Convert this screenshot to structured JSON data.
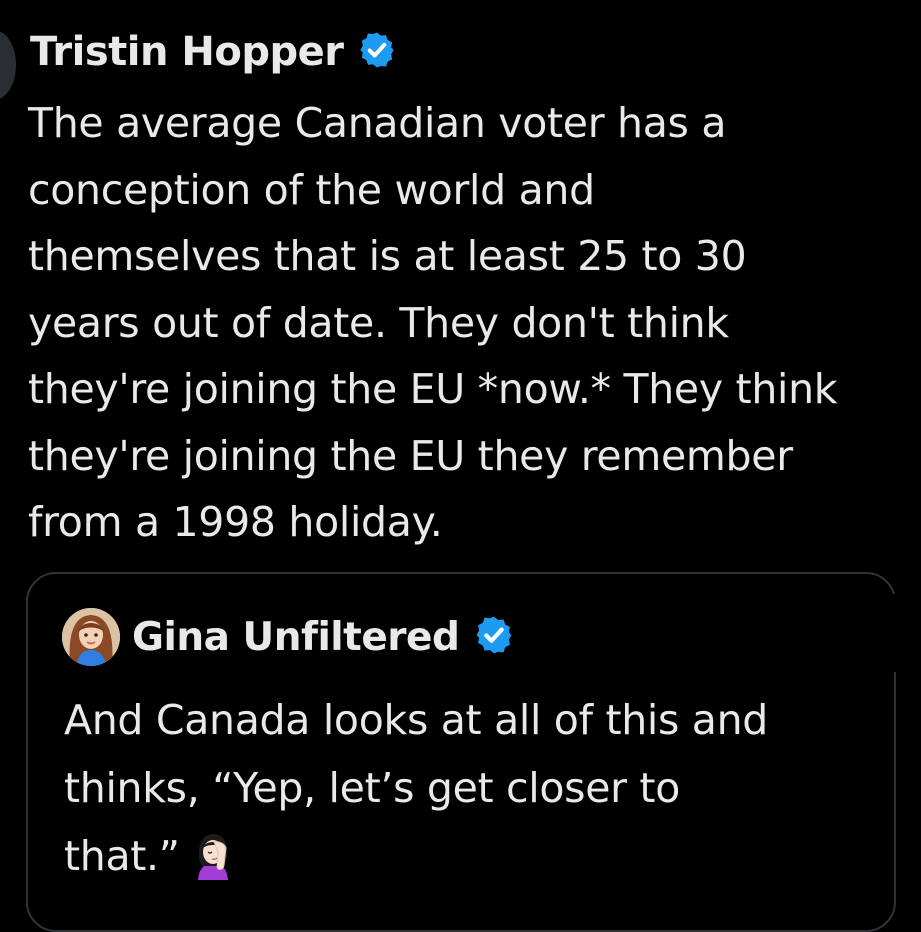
{
  "tweet": {
    "author_name": "Tristin Hopper",
    "verified_icon": "verified-badge-icon",
    "text": "The average Canadian voter has a\nconception of the world and\nthemselves that is at least 25 to 30\nyears out of date. They don't think\nthey're joining the EU *now.* They think\nthey're joining the EU they remember\nfrom a 1998 holiday."
  },
  "quoted_tweet": {
    "author_name": "Gina Unfiltered",
    "avatar_icon": "profile-avatar",
    "verified_icon": "verified-badge-icon",
    "text": "And Canada looks at all of this and\nthinks, “Yep, let’s get closer to\nthat.”",
    "emoji_icon": "facepalm-emoji-icon"
  },
  "colors": {
    "background": "#000000",
    "text": "#e7e9ea",
    "verified_blue": "#1d9bf0",
    "card_border": "#2f3336"
  }
}
